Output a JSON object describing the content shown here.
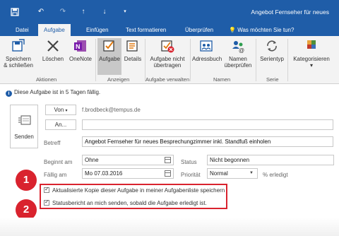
{
  "window": {
    "title": "Angebot Fernseher für neues",
    "quick_access": [
      "save-icon",
      "undo-icon",
      "redo-icon",
      "up-arrow-icon",
      "down-arrow-icon",
      "customize-icon"
    ]
  },
  "tabs": [
    "Datei",
    "Aufgabe",
    "Einfügen",
    "Text formatieren",
    "Überprüfen"
  ],
  "active_tab": "Aufgabe",
  "tell_me": "Was möchten Sie tun?",
  "ribbon": {
    "groups": {
      "aktionen": {
        "label": "Aktionen",
        "save_close": [
          "Speichern",
          "& schließen"
        ],
        "delete": "Löschen",
        "onenote": "OneNote"
      },
      "anzeigen": {
        "label": "Anzeigen",
        "task": "Aufgabe",
        "details": "Details"
      },
      "aufgabe_verwalten": {
        "label": "Aufgabe verwalten",
        "mark_complete": [
          "Aufgabe nicht",
          "übertragen"
        ]
      },
      "namen": {
        "label": "Namen",
        "address_book": "Adressbuch",
        "check_names": [
          "Namen",
          "überprüfen"
        ]
      },
      "serie": {
        "label": "Serie",
        "recurrence": "Serientyp"
      },
      "categorize": {
        "label": "Kategorisieren"
      }
    }
  },
  "info_bar": "Diese Aufgabe ist in 5 Tagen fällig.",
  "form": {
    "send_label": "Senden",
    "from_button": "Von",
    "from_value": "f.brodbeck@tempus.de",
    "to_button": "An...",
    "to_value": "",
    "subject_label": "Betreff",
    "subject_value": "Angebot Fernseher für neues Besprechungzimmer inkl. Standfuß einholen",
    "start_label": "Beginnt am",
    "start_value": "Ohne",
    "due_label": "Fällig am",
    "due_value": "Mo 07.03.2016",
    "status_label": "Status",
    "status_value": "Nicht begonnen",
    "priority_label": "Priorität",
    "priority_value": "Normal",
    "percent_label": "% erledigt"
  },
  "checkboxes": [
    {
      "label": "Aktualisierte Kopie dieser Aufgabe in meiner Aufgabenliste speichern",
      "checked": true
    },
    {
      "label": "Statusbericht an mich senden, sobald die Aufgabe erledigt ist.",
      "checked": true
    }
  ],
  "callouts": [
    "1",
    "2"
  ],
  "colors": {
    "title_bar": "#1f5da8",
    "ribbon": "#f3f3f3",
    "highlight": "#d9232e"
  }
}
